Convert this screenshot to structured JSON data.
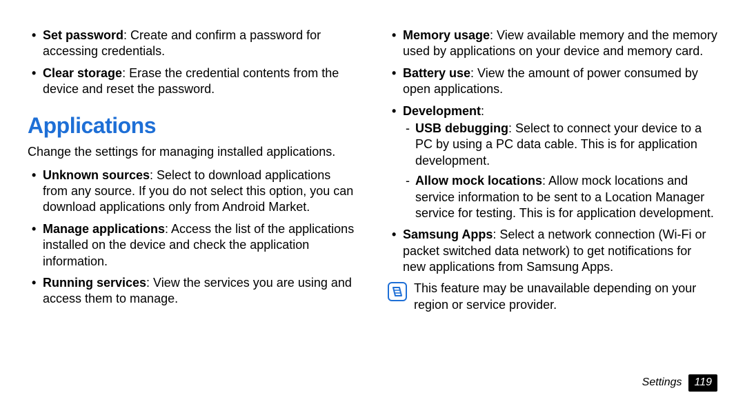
{
  "left": {
    "top_bullets": [
      {
        "term": "Set password",
        "desc": ": Create and confirm a password for accessing credentials."
      },
      {
        "term": "Clear storage",
        "desc": ": Erase the credential contents from the device and reset the password."
      }
    ],
    "section_title": "Applications",
    "section_intro": "Change the settings for managing installed applications.",
    "section_bullets": [
      {
        "term": "Unknown sources",
        "desc": ": Select to download applications from any source. If you do not select this option, you can download applications only from Android Market."
      },
      {
        "term": "Manage applications",
        "desc": ": Access the list of the applications installed on the device and check the application information."
      },
      {
        "term": "Running services",
        "desc": ": View the services you are using and access them to manage."
      }
    ]
  },
  "right": {
    "bullets": [
      {
        "term": "Memory usage",
        "desc": ": View available memory and the memory used by applications on your device and memory card."
      },
      {
        "term": "Battery use",
        "desc": ": View the amount of power consumed by open applications."
      },
      {
        "term": "Development",
        "desc": ":",
        "sub": [
          {
            "term": "USB debugging",
            "desc": ": Select to connect your device to a PC by using a PC data cable. This is for application development."
          },
          {
            "term": "Allow mock locations",
            "desc": ": Allow mock locations and service information to be sent to a Location Manager service for testing. This is for application development."
          }
        ]
      },
      {
        "term": "Samsung Apps",
        "desc": ": Select a network connection (Wi-Fi or packet switched data network) to get notifications for new applications from Samsung Apps."
      }
    ],
    "note": "This feature may be unavailable depending on your region or service provider."
  },
  "footer": {
    "chapter": "Settings",
    "page": "119"
  }
}
